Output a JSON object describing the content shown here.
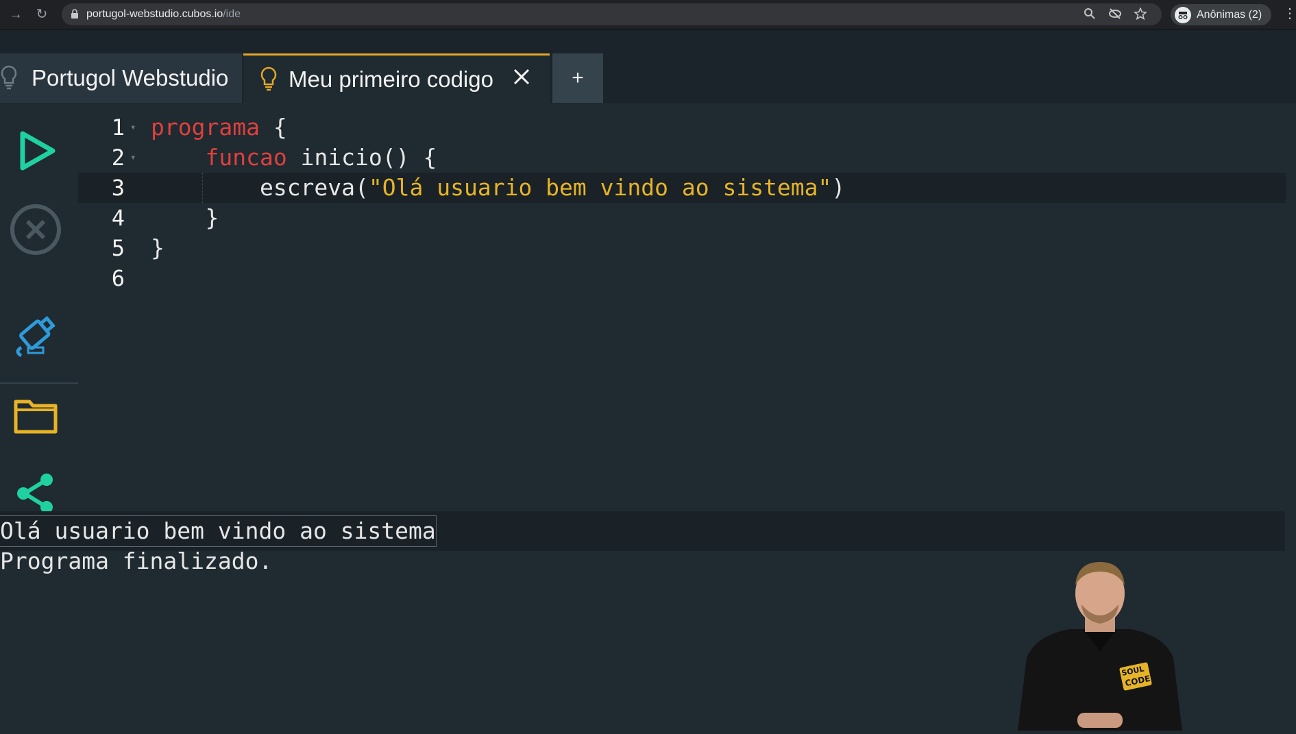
{
  "browser": {
    "url_host": "portugol-webstudio.cubos.io",
    "url_path": "/ide",
    "profile_label": "Anônimas (2)"
  },
  "tabs": [
    {
      "label": "Portugol Webstudio"
    },
    {
      "label": "Meu primeiro codigo"
    },
    {
      "label": "+"
    }
  ],
  "sidebar": {
    "items": [
      "play-icon",
      "stop-icon",
      "save-device-icon",
      "folder-icon",
      "share-icon"
    ]
  },
  "editor": {
    "lines": [
      {
        "num": "1",
        "indent": "",
        "tokens": [
          [
            "kw",
            "programa"
          ],
          [
            "plain",
            " {"
          ]
        ]
      },
      {
        "num": "2",
        "indent": "    ",
        "tokens": [
          [
            "kw",
            "funcao"
          ],
          [
            "plain",
            " inicio() {"
          ]
        ]
      },
      {
        "num": "3",
        "indent": "        ",
        "tokens": [
          [
            "plain",
            "escreva("
          ],
          [
            "str",
            "\"Olá usuario bem vindo ao sistema\""
          ],
          [
            "plain",
            ")"
          ]
        ]
      },
      {
        "num": "4",
        "indent": "    ",
        "tokens": [
          [
            "plain",
            "}"
          ]
        ]
      },
      {
        "num": "5",
        "indent": "",
        "tokens": [
          [
            "plain",
            "}"
          ]
        ]
      },
      {
        "num": "6",
        "indent": "",
        "tokens": []
      }
    ],
    "active_line": 3
  },
  "console": {
    "output": "Olá usuario bem vindo ao sistema",
    "status": "Programa finalizado."
  },
  "presenter": {
    "badge_line1": "SOUL",
    "badge_line2": "CODE"
  },
  "colors": {
    "accent": "#e5a823",
    "keyword": "#e0403d",
    "string": "#e8b425",
    "play": "#1fd1a1",
    "save": "#2e9bd9",
    "folder": "#e8b425",
    "share": "#1fd1a1"
  }
}
